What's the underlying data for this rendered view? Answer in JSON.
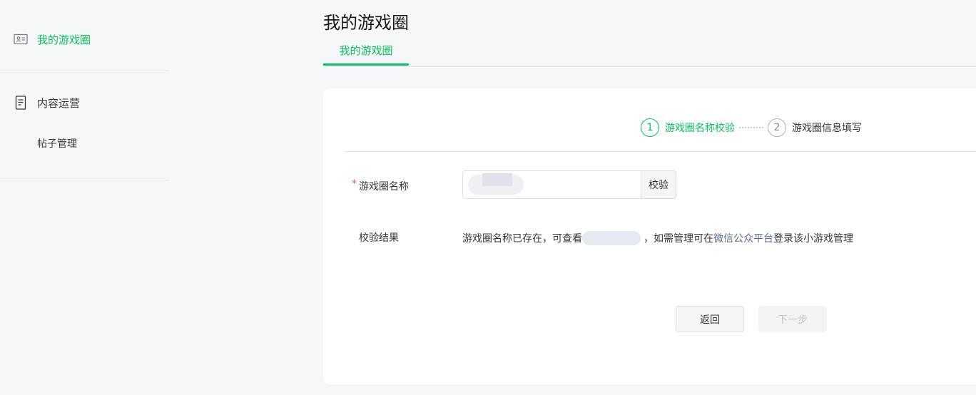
{
  "sidebar": {
    "items": [
      {
        "label": "我的游戏圈",
        "icon": "id-card-icon",
        "active": true
      },
      {
        "label": "内容运营",
        "icon": "document-icon",
        "active": false,
        "children": [
          {
            "label": "帖子管理"
          }
        ]
      }
    ]
  },
  "header": {
    "title": "我的游戏圈",
    "tabs": [
      {
        "label": "我的游戏圈",
        "active": true
      }
    ]
  },
  "steps": [
    {
      "number": "1",
      "label": "游戏圈名称校验",
      "state": "active"
    },
    {
      "number": "2",
      "label": "游戏圈信息填写",
      "state": "pending"
    }
  ],
  "form": {
    "required_mark": "*",
    "name_label": "游戏圈名称",
    "name_value": "",
    "verify_button": "校验",
    "result_label": "校验结果",
    "result_prefix": "游戏圈名称已存在，可查看",
    "result_middle": "，如需管理可在",
    "result_link": "微信公众平台",
    "result_suffix": "登录该小游戏管理"
  },
  "actions": {
    "back_label": "返回",
    "next_label": "下一步"
  },
  "colors": {
    "accent": "#07c160",
    "link": "#576b95",
    "required": "#fa5151",
    "background": "#f6f7f9"
  }
}
